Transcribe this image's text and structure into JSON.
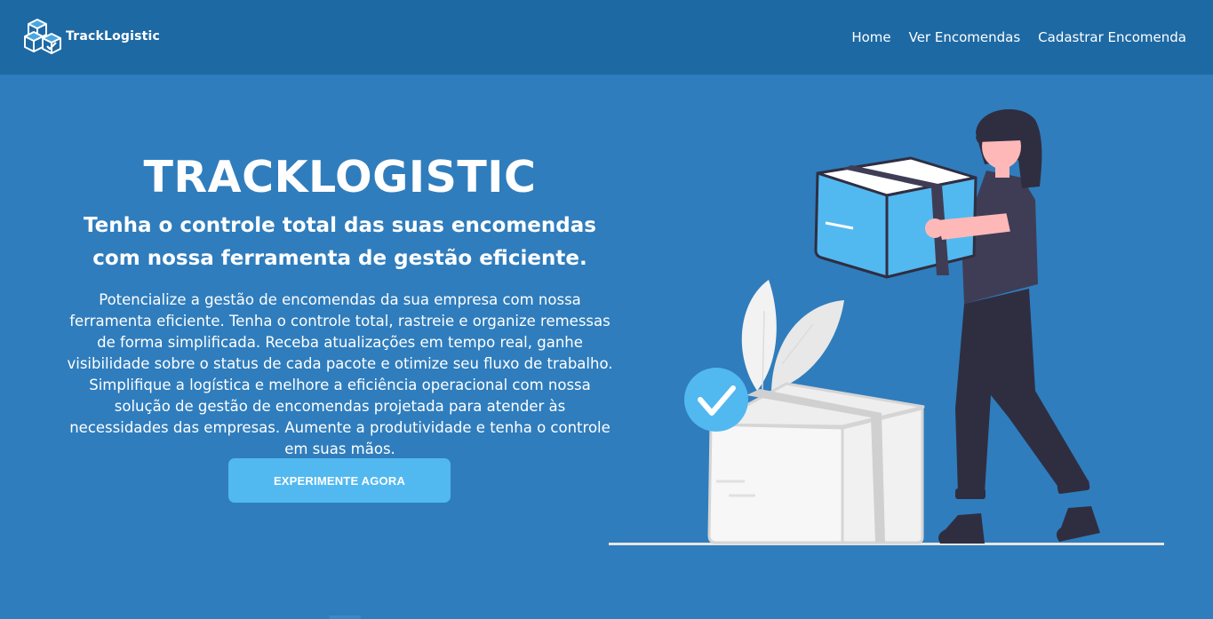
{
  "nav": {
    "brand": "TrackLogistic",
    "links": [
      "Home",
      "Ver Encomendas",
      "Cadastrar Encomenda"
    ]
  },
  "hero": {
    "title": "TRACKLOGISTIC",
    "subtitle": "Tenha o controle total das suas encomendas com nossa ferramenta de gestão eficiente.",
    "description": "Potencialize a gestão de encomendas da sua empresa com nossa ferramenta eficiente. Tenha o controle total, rastreie e organize remessas de forma simplificada. Receba atualizações em tempo real, ganhe visibilidade sobre o status de cada pacote e otimize seu fluxo de trabalho. Simplifique a logística e melhore a eficiência operacional com nossa solução de gestão de encomendas projetada para atender às necessidades das empresas. Aumente a produtividade e tenha o controle em suas mãos.",
    "cta": "EXPERIMENTE AGORA"
  },
  "colors": {
    "navbar": "#1d69a4",
    "background": "#2f7dbd",
    "accent": "#52b8f0",
    "text": "#ffffff"
  },
  "icons": {
    "logo": "boxes-logo-icon",
    "illustration": "woman-carrying-box-illustration",
    "check": "check-circle-icon"
  }
}
